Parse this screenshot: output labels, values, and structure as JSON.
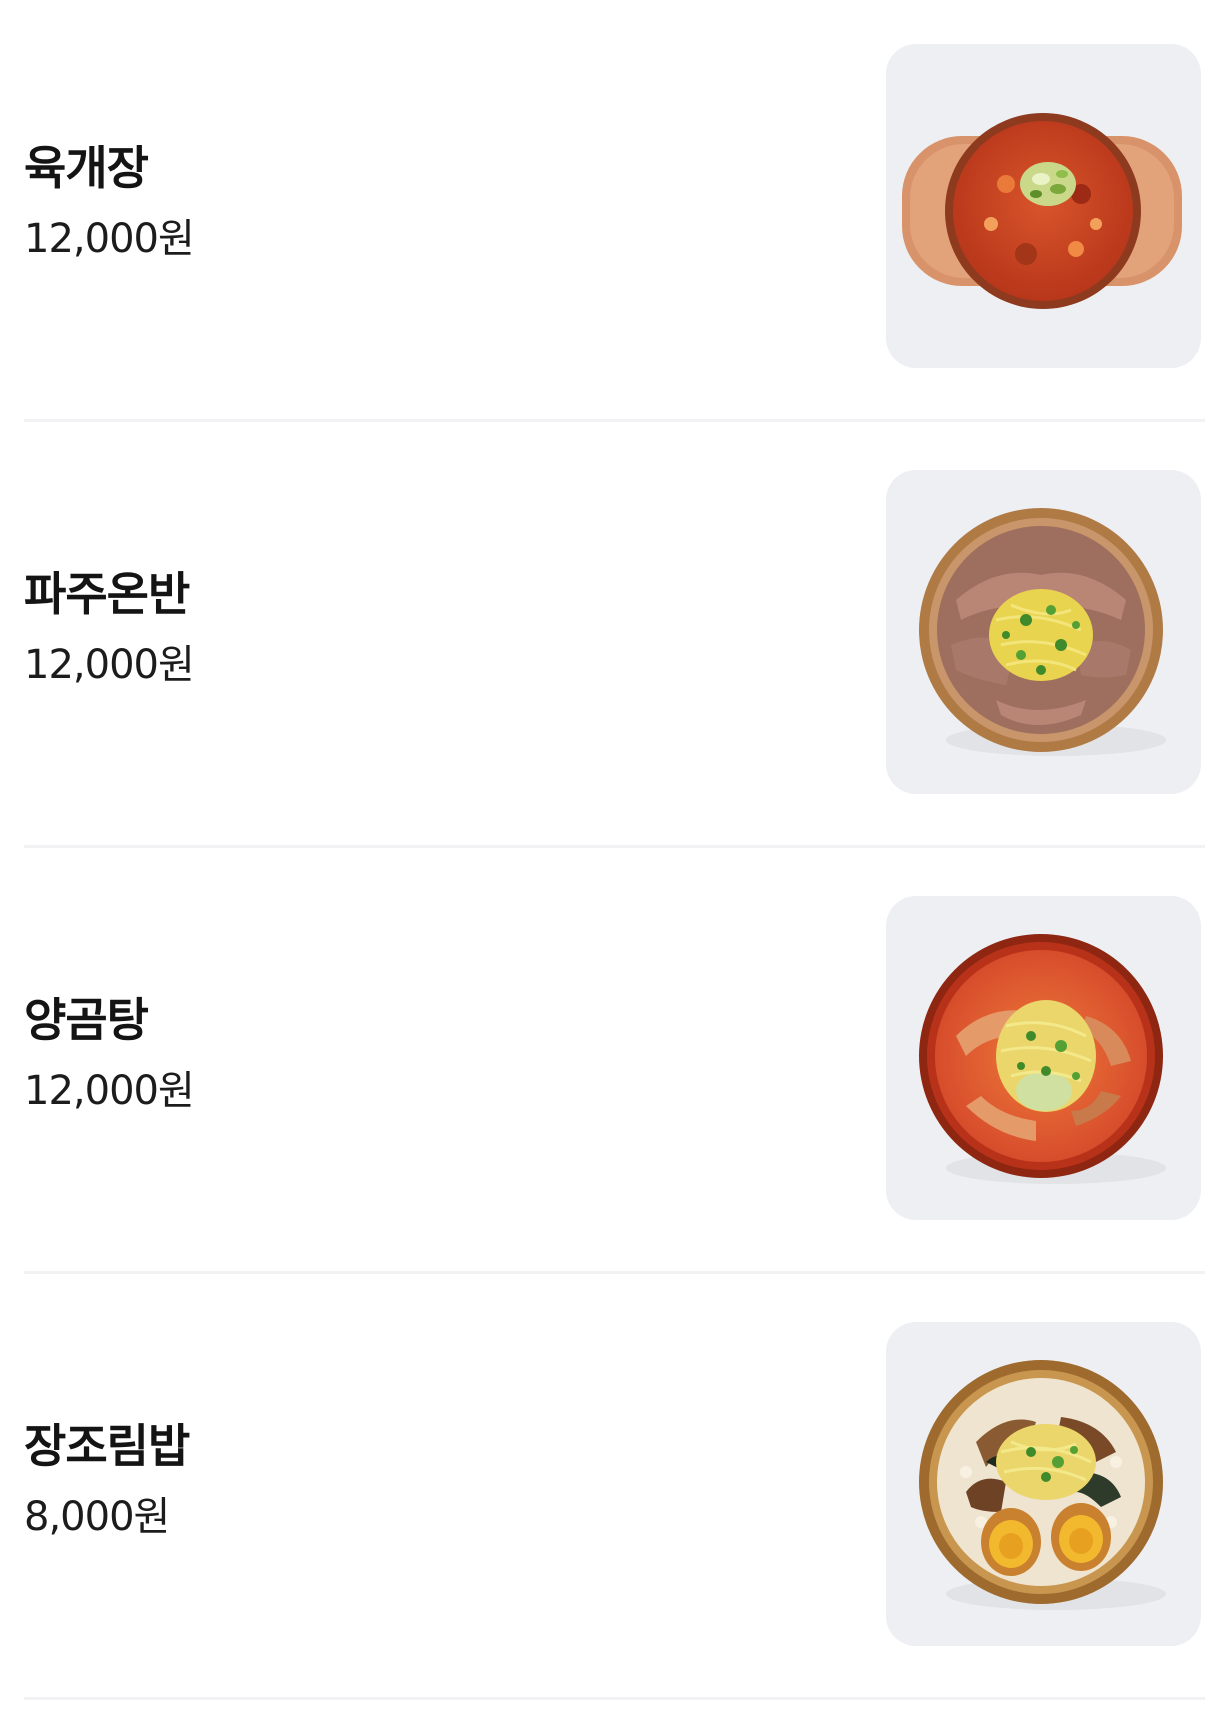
{
  "menu": {
    "items": [
      {
        "name": "육개장",
        "price": "12,000원",
        "image": "yukgaejang-dish-image"
      },
      {
        "name": "파주온반",
        "price": "12,000원",
        "image": "pajuonban-dish-image"
      },
      {
        "name": "양곰탕",
        "price": "12,000원",
        "image": "yanggomtang-dish-image"
      },
      {
        "name": "장조림밥",
        "price": "8,000원",
        "image": "jangjorimbap-dish-image"
      }
    ]
  },
  "colors": {
    "background": "#ffffff",
    "text": "#141414",
    "divider": "#f2f2f4",
    "thumb_background": "#eeeff3"
  }
}
